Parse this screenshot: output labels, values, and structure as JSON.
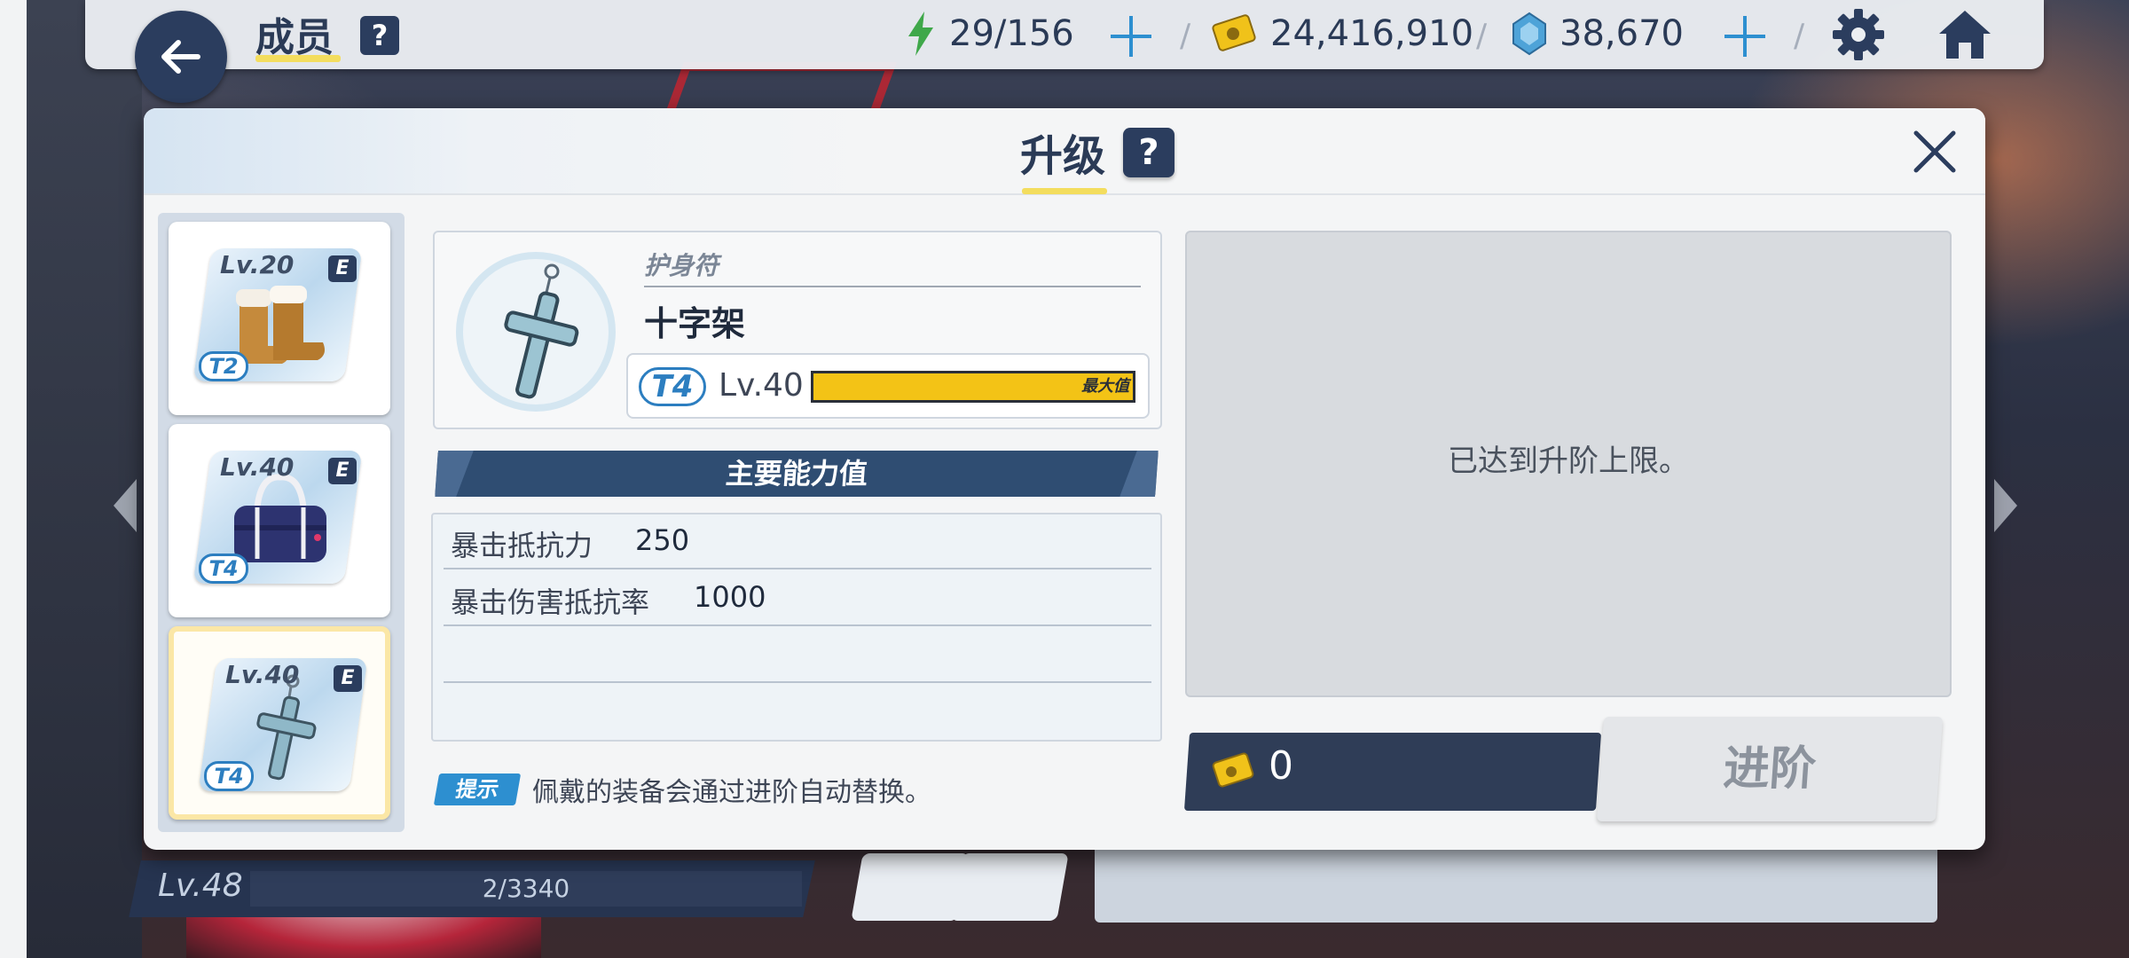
{
  "topbar": {
    "title": "成员",
    "help": "?",
    "stamina": "29/156",
    "credits": "24,416,910",
    "gems": "38,670"
  },
  "background": {
    "player_level": "Lv.48",
    "exp": "2/3340"
  },
  "dialog": {
    "title": "升级",
    "help": "?",
    "equipment_list": [
      {
        "level": "Lv.20",
        "grade": "E",
        "tier": "T2",
        "icon": "boots-icon"
      },
      {
        "level": "Lv.40",
        "grade": "E",
        "tier": "T4",
        "icon": "bag-icon"
      },
      {
        "level": "Lv.40",
        "grade": "E",
        "tier": "T4",
        "icon": "cross-icon",
        "selected": true
      }
    ],
    "item": {
      "category": "护身符",
      "name": "十字架",
      "tier": "T4",
      "level": "Lv.40",
      "max_label": "最大值",
      "exp_fill": 1.0
    },
    "stats_header": "主要能力值",
    "stats": [
      {
        "name": "暴击抵抗力",
        "value": "250"
      },
      {
        "name": "暴击伤害抵抗率",
        "value": "1000"
      },
      {
        "name": "",
        "value": ""
      }
    ],
    "tip_badge": "提示",
    "tip_text": "佩戴的装备会通过进阶自动替换。",
    "limit_message": "已达到升阶上限。",
    "cost": "0",
    "advance_button": "进阶"
  },
  "colors": {
    "navy": "#2b3d5e",
    "accent_blue": "#2d8fd0",
    "gold": "#f3c316",
    "highlight_yellow": "#f3dd5e"
  }
}
